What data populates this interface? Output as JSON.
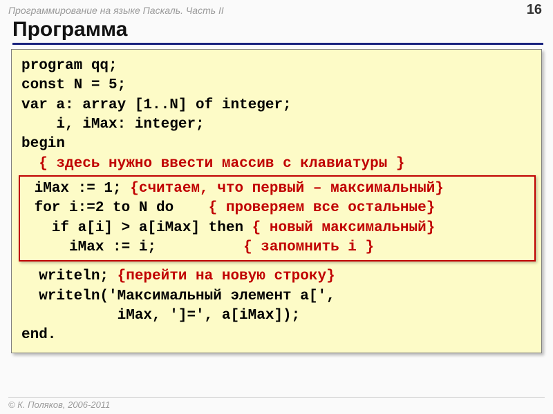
{
  "header": {
    "course": "Программирование на языке Паскаль. Часть II",
    "page": "16"
  },
  "title": "Программа",
  "code": {
    "l1": "program qq;",
    "l2": "const N = 5;",
    "l3": "var a: array [1..N] of integer;",
    "l4": "    i, iMax: integer;",
    "l5": "begin",
    "l6a": "  ",
    "l6b": "{ здесь нужно ввести массив с клавиатуры }",
    "l7a": " iMax := 1; ",
    "l7b": "{считаем, что первый – максимальный}",
    "l8a": " for i:=2 to N do    ",
    "l8b": "{ проверяем все остальные}",
    "l9a": "   if a[i] > a[iMax] then ",
    "l9b": "{ новый максимальный}",
    "l10a": "     iMax := i;          ",
    "l10b": "{ запомнить i }",
    "l11a": "  writeln; ",
    "l11b": "{перейти на новую строку}",
    "l12": "  writeln('Максимальный элемент a[',",
    "l13": "           iMax, ']=', a[iMax]);",
    "l14": "end."
  },
  "footer": "© К. Поляков, 2006-2011"
}
